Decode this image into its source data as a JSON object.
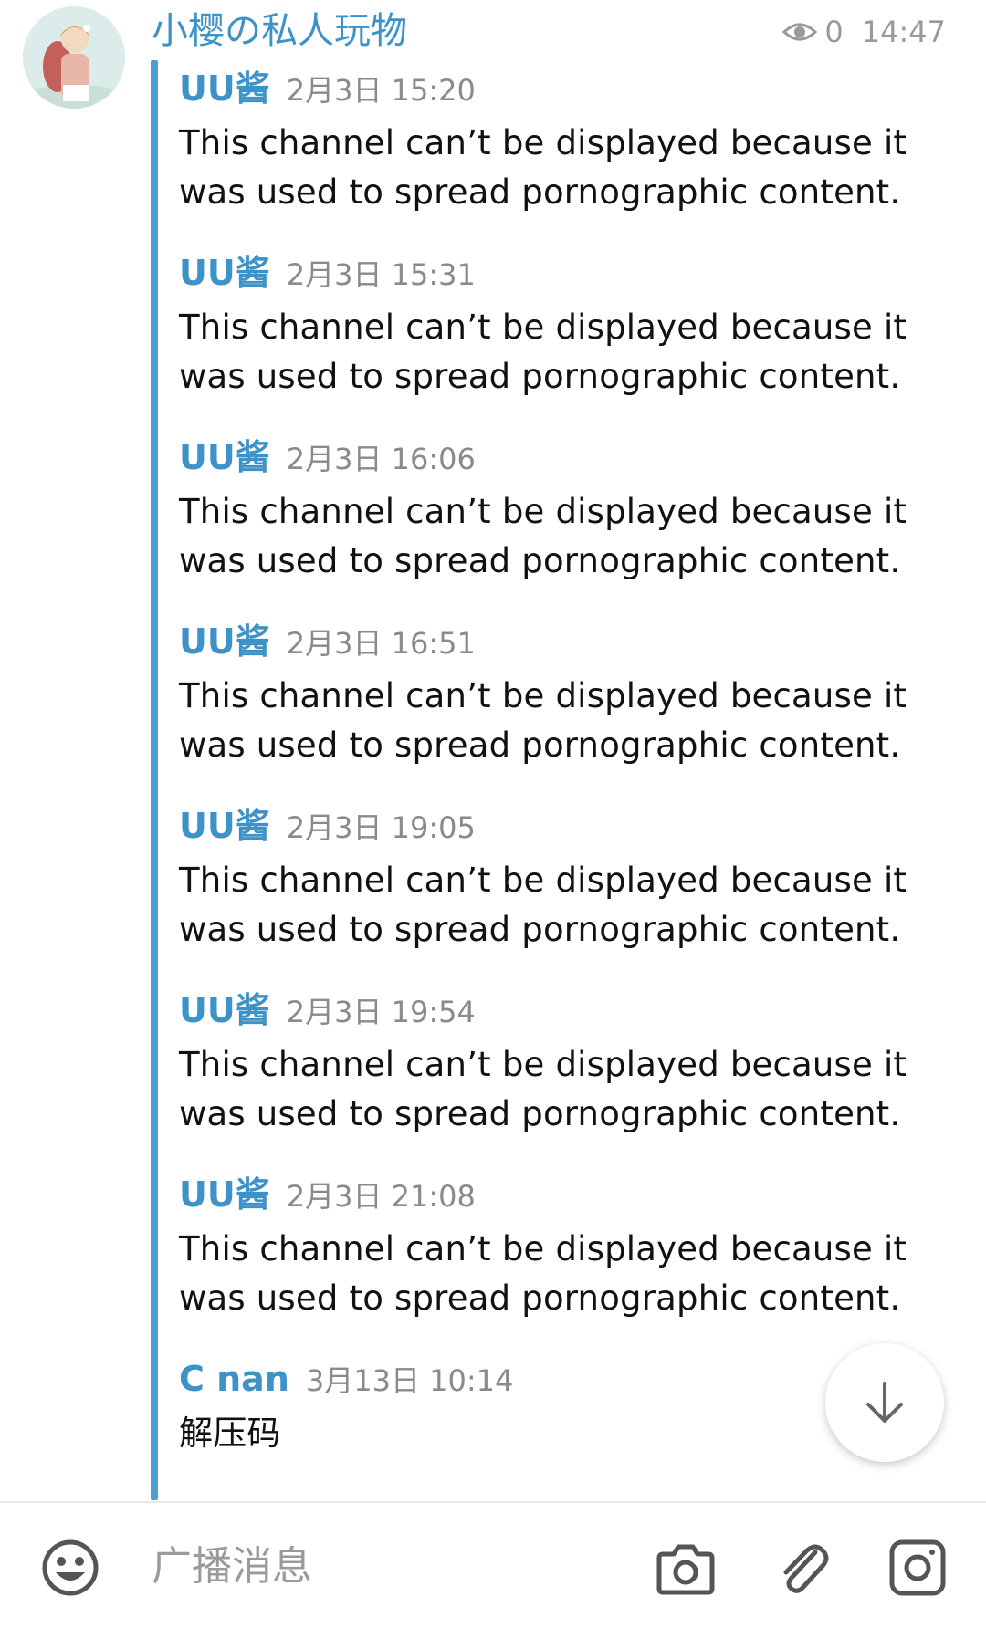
{
  "channel": {
    "title": "小樱の私人玩物",
    "views": "0",
    "time": "14:47"
  },
  "messages": [
    {
      "author": "UU酱",
      "date": "2月3日 15:20",
      "text_line1": "This channel can’t be displayed because it",
      "text_line2": "was used to spread pornographic content."
    },
    {
      "author": "UU酱",
      "date": "2月3日 15:31",
      "text_line1": "This channel can’t be displayed because it",
      "text_line2": "was used to spread pornographic content."
    },
    {
      "author": "UU酱",
      "date": "2月3日 16:06",
      "text_line1": "This channel can’t be displayed because it",
      "text_line2": "was used to spread pornographic content."
    },
    {
      "author": "UU酱",
      "date": "2月3日 16:51",
      "text_line1": "This channel can’t be displayed because it",
      "text_line2": "was used to spread pornographic content."
    },
    {
      "author": "UU酱",
      "date": "2月3日 19:05",
      "text_line1": "This channel can’t be displayed because it",
      "text_line2": "was used to spread pornographic content."
    },
    {
      "author": "UU酱",
      "date": "2月3日 19:54",
      "text_line1": "This channel can’t be displayed because it",
      "text_line2": "was used to spread pornographic content."
    },
    {
      "author": "UU酱",
      "date": "2月3日 21:08",
      "text_line1": "This channel can’t be displayed because it",
      "text_line2": "was used to spread pornographic content."
    },
    {
      "author": "C nan",
      "date": "3月13日 10:14",
      "text_line1": "解压码",
      "text_line2": ""
    }
  ],
  "composer": {
    "placeholder": "广播消息"
  },
  "icons": {
    "views": "eye-icon",
    "scroll": "arrow-down-icon",
    "emoji": "emoji-icon",
    "camera": "camera-icon",
    "attach": "paperclip-icon",
    "instant_camera": "instant-camera-icon"
  },
  "colors": {
    "accent": "#3d92c8",
    "quote_bar": "#4d9fd4",
    "muted": "#8a8a8a",
    "icon": "#555555"
  }
}
